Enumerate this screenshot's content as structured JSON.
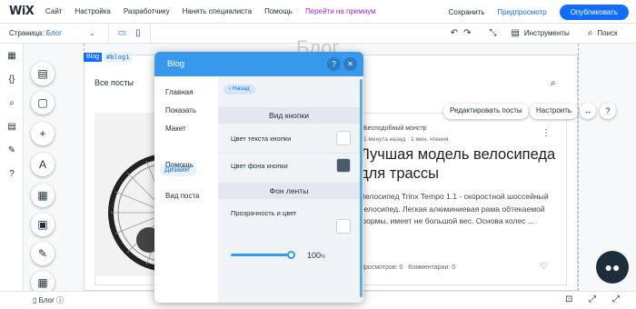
{
  "topbar": {
    "logo": "WiX",
    "menu": [
      "Сайт",
      "Настройка",
      "Разработчику",
      "Нанять специалиста",
      "Помощь"
    ],
    "premium": "Перейти на премиум",
    "save": "Сохранить",
    "preview": "Предпросмотр",
    "upgrade": "Опубликовать"
  },
  "subbar": {
    "page_label": "Страница:",
    "page_value": "Блог",
    "tools": "Инструменты",
    "search": "Поиск"
  },
  "canvas": {
    "tag_blog": "Blog",
    "tag_id": "#blog1",
    "header_text": "Блог",
    "all_posts": "Все посты",
    "edit_posts": "Редактировать посты",
    "configure": "Настроить",
    "author": "Бесподобный монстр",
    "meta": "1 минута назад · 1 мин. чтения",
    "title": "Лучшая модель велосипеда для трассы",
    "excerpt": "Велосипед Trinx Tempo 1.1 - скоростной шоссейный велосипед. Легкая алюминиевая рама обтекаемой формы, имеет не большой вес. Основа колес ...",
    "views": "Просмотров: 0",
    "comments": "Комментарии: 0"
  },
  "panel": {
    "title": "Blog",
    "nav": [
      "Главная",
      "Показать",
      "Макет",
      "Дизайн",
      "Помощь",
      "Вид поста"
    ],
    "active": "Дизайн",
    "back": "Назад",
    "section_buttons": "Вид кнопки",
    "text_color": "Цвет текста кнопки",
    "bg_color": "Цвет фона кнопки",
    "section_feed": "Фон ленты",
    "opacity": "Прозрачность и цвет",
    "opacity_value": "100",
    "opacity_unit": "%"
  },
  "bottombar": {
    "blog_label": "Блог"
  },
  "colors": {
    "accent": "#116dff",
    "panel_header": "#3899ec",
    "swatch_dark": "#4a5a6a",
    "premium": "#9a27d5"
  },
  "icons": [
    "desktop-icon",
    "mobile-icon",
    "undo-icon",
    "redo-icon",
    "zoom-icon",
    "tools-icon",
    "search-icon",
    "help-icon",
    "close-icon",
    "chat-icon",
    "heart-icon",
    "kebab-icon",
    "back-arrow-icon"
  ]
}
